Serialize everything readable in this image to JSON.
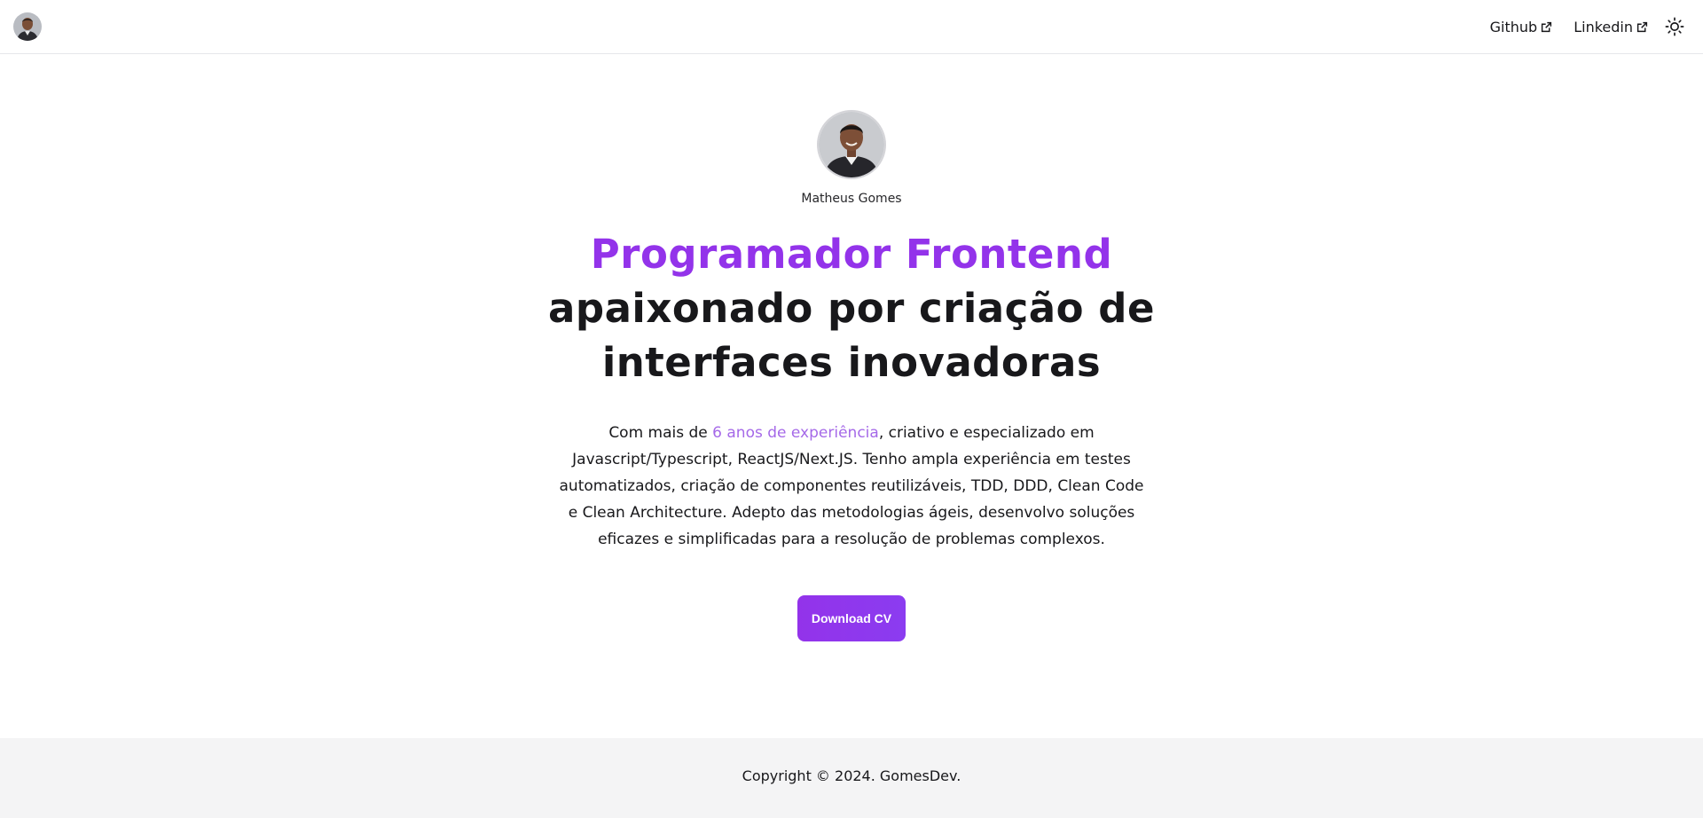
{
  "header": {
    "nav": [
      {
        "label": "Github",
        "icon": "external-link-icon"
      },
      {
        "label": "Linkedin",
        "icon": "external-link-icon"
      }
    ],
    "theme_icon": "sun-icon"
  },
  "hero": {
    "name": "Matheus Gomes",
    "headline_accent": "Programador Frontend",
    "headline_rest": "apaixonado por criação de interfaces inovadoras",
    "intro_before": "Com mais de ",
    "intro_highlight": "6 anos de experiência",
    "intro_after": ", criativo e especializado em Javascript/Typescript, ReactJS/Next.JS. Tenho ampla experiência em testes automatizados, criação de componentes reutilizáveis, TDD, DDD, Clean Code e Clean Architecture. Adepto das metodologias ágeis, desenvolvo soluções eficazes e simplificadas para a resolução de problemas complexos.",
    "cta_label": "Download CV"
  },
  "footer": {
    "copyright": "Copyright © 2024. GomesDev."
  },
  "colors": {
    "accent": "#9333ea",
    "highlight": "#a569e8",
    "footer_bg": "#f4f4f5"
  }
}
